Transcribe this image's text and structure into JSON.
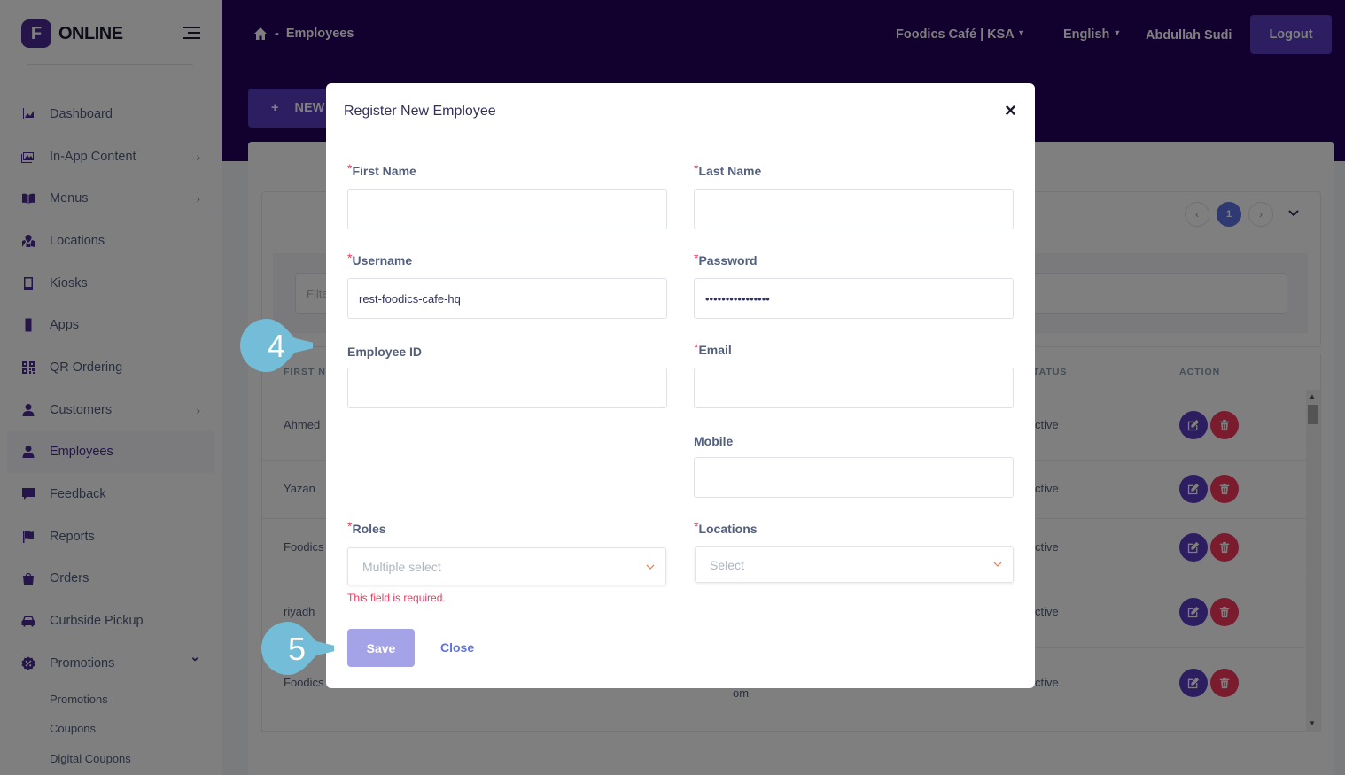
{
  "sidebar": {
    "logo_mark": "F",
    "logo_text": "ONLINE",
    "items": [
      {
        "label": "Dashboard",
        "icon": "chart-area-icon",
        "arrow": ""
      },
      {
        "label": "In-App Content",
        "icon": "images-icon",
        "arrow": "›"
      },
      {
        "label": "Menus",
        "icon": "book-open-icon",
        "arrow": "›"
      },
      {
        "label": "Locations",
        "icon": "map-marked-icon",
        "arrow": ""
      },
      {
        "label": "Kiosks",
        "icon": "tablet-icon",
        "arrow": ""
      },
      {
        "label": "Apps",
        "icon": "mobile-icon",
        "arrow": ""
      },
      {
        "label": "QR Ordering",
        "icon": "qrcode-icon",
        "arrow": ""
      },
      {
        "label": "Customers",
        "icon": "user-icon",
        "arrow": "›"
      },
      {
        "label": "Employees",
        "icon": "user-icon",
        "arrow": ""
      },
      {
        "label": "Feedback",
        "icon": "comment-icon",
        "arrow": ""
      },
      {
        "label": "Reports",
        "icon": "flag-icon",
        "arrow": ""
      },
      {
        "label": "Orders",
        "icon": "shopping-bag-icon",
        "arrow": ""
      },
      {
        "label": "Curbside Pickup",
        "icon": "car-icon",
        "arrow": ""
      },
      {
        "label": "Promotions",
        "icon": "percent-badge-icon",
        "arrow": "⌄"
      }
    ],
    "sub_items": [
      "Promotions",
      "Coupons",
      "Digital Coupons"
    ]
  },
  "topbar": {
    "breadcrumb_sep": "-",
    "breadcrumb": "Employees",
    "brand_select": "Foodics Café | KSA",
    "language": "English",
    "user": "Abdullah Sudi",
    "logout": "Logout",
    "new_button": "NEW"
  },
  "list": {
    "filter_placeholder": "Filte",
    "page_prev": "‹",
    "page_current": "1",
    "page_next": "›",
    "col_first_name": "FIRST N",
    "col_status": "TATUS",
    "col_action": "ACTION",
    "rows": [
      {
        "first": "Ahmed",
        "status": "ctive",
        "extra": ""
      },
      {
        "first": "Yazan",
        "status": "ctive",
        "extra": ""
      },
      {
        "first": "Foodics",
        "status": "ctive",
        "extra": ""
      },
      {
        "first": "riyadh",
        "status": "ctive",
        "extra": ""
      },
      {
        "first": "Foodics",
        "status": "ctive",
        "extra": "om"
      }
    ]
  },
  "modal": {
    "title": "Register New Employee",
    "close_icon": "×",
    "required_mark": "*",
    "first_name_label": "First Name",
    "last_name_label": "Last Name",
    "username_label": "Username",
    "username_value": "rest-foodics-cafe-hq",
    "password_label": "Password",
    "password_value": "••••••••••••••••",
    "employee_id_label": "Employee ID",
    "email_label": "Email",
    "mobile_label": "Mobile",
    "roles_label": "Roles",
    "roles_placeholder": "Multiple select",
    "locations_label": "Locations",
    "locations_placeholder": "Select",
    "error_text": "This field is required.",
    "save": "Save",
    "close": "Close"
  },
  "callouts": {
    "step4": "4",
    "step5": "5",
    "color": "#74bdd8"
  }
}
